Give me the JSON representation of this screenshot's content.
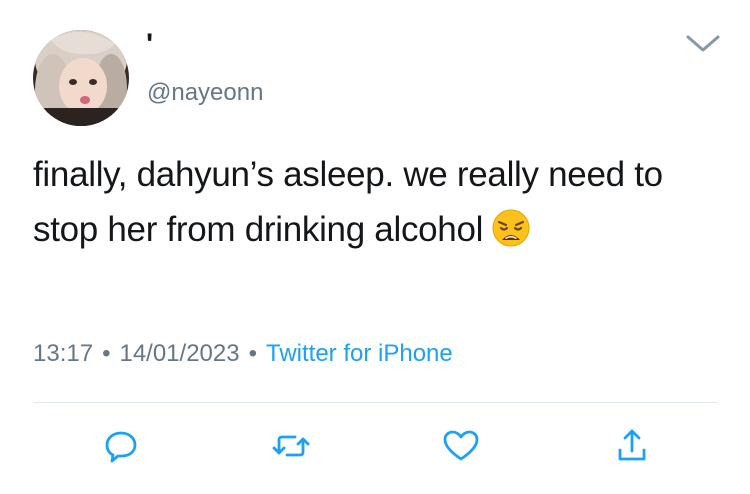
{
  "tweet": {
    "display_name": "'",
    "handle": "@nayeonn",
    "text": "finally, dahyun’s asleep. we really need to stop her from drinking alcohol",
    "emoji": "weary-face-emoji",
    "time": "13:17",
    "separator": "•",
    "date": "14/01/2023",
    "source": "Twitter for iPhone"
  },
  "actions": [
    {
      "name": "reply",
      "icon": "speech-bubble-icon"
    },
    {
      "name": "retweet",
      "icon": "retweet-arrows-icon"
    },
    {
      "name": "like",
      "icon": "heart-icon"
    },
    {
      "name": "share",
      "icon": "share-upload-icon"
    }
  ],
  "colors": {
    "text": "#14171a",
    "secondary": "#657786",
    "link": "#1da1f2",
    "icon": "#1da1f2",
    "divider": "#e1e8ed"
  }
}
